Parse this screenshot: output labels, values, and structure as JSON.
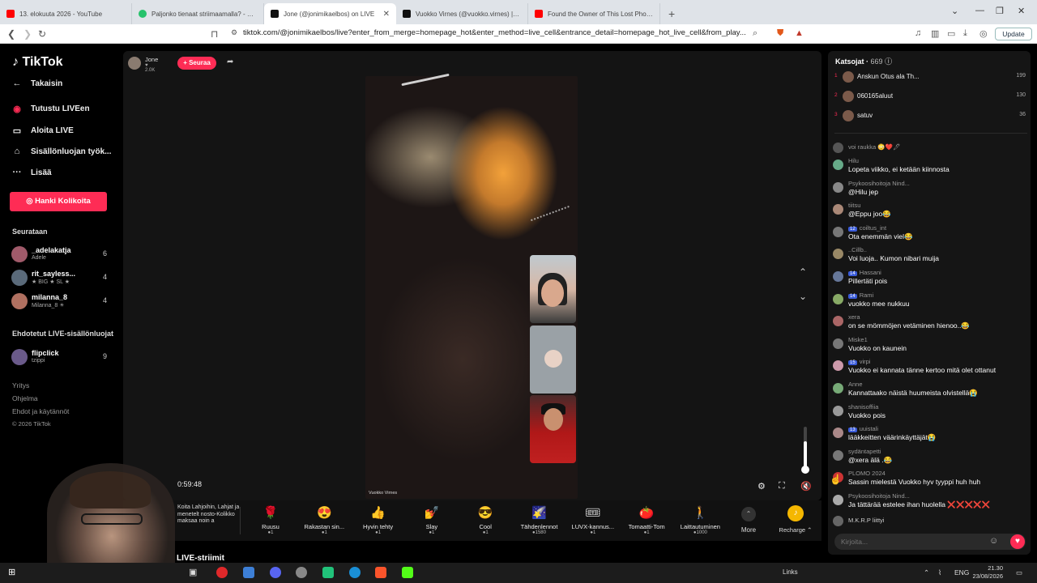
{
  "browser": {
    "tabs": [
      {
        "title": "13. elokuuta 2026 - YouTube",
        "color": "#ff0000",
        "active": false
      },
      {
        "title": "Paljonko tienaat striimaamalla? - Le...",
        "color": "#26c26b",
        "active": false
      },
      {
        "title": "Jone (@jonimikaelbos) on LIVE",
        "color": "#111111",
        "active": true
      },
      {
        "title": "Vuokko Virnes (@vuokko.virnes) | Ti...",
        "color": "#111111",
        "active": false
      },
      {
        "title": "Found the Owner of This Lost Phon...",
        "color": "#ff0000",
        "active": false
      }
    ],
    "url": "tiktok.com/@jonimikaelbos/live?enter_from_merge=homepage_hot&enter_method=live_cell&entrance_detail=homepage_hot_live_cell&from_play...",
    "update_label": "Update"
  },
  "sidebar": {
    "logo": "TikTok",
    "back": "Takaisin",
    "nav": [
      "Tutustu LIVEen",
      "Aloita LIVE",
      "Sisällönluojan työk...",
      "Lisää"
    ],
    "coins_button": "Hanki Kolikoita",
    "following_title": "Seurataan",
    "following": [
      {
        "name": "_adelakatja",
        "sub": "Adele",
        "count": "6"
      },
      {
        "name": "rit_sayless...",
        "sub": "★ BIG ★ SL ★",
        "count": "4"
      },
      {
        "name": "milanna_8",
        "sub": "Milanna_8 ☀",
        "count": "4"
      }
    ],
    "suggested_title": "Ehdotetut LIVE-sisällönluojat",
    "suggested": [
      {
        "name": "flipclick",
        "sub": "tzippi",
        "count": "9"
      }
    ],
    "footer": [
      "Yritys",
      "Ohjelma",
      "Ehdot ja käytännöt",
      "© 2026 TikTok"
    ]
  },
  "live": {
    "host_name": "Jone",
    "host_likes": "2.0K",
    "follow_button": "+ Seuraa",
    "video_credit": "Vuokko Virnes",
    "timer": "0:59:48",
    "live_label": "LIVE-striimit",
    "gift_desc": "Koita Lahjoihin, Lahjat ja menetelt nosto-Kolikko maksaa noin a"
  },
  "gifts": [
    {
      "name": "Ruusu",
      "price": "1",
      "icon": "🌹"
    },
    {
      "name": "Rakastan sin...",
      "price": "1",
      "icon": "😍"
    },
    {
      "name": "Hyvin tehty",
      "price": "1",
      "icon": "👍"
    },
    {
      "name": "Slay",
      "price": "1",
      "icon": "💅"
    },
    {
      "name": "Cool",
      "price": "1",
      "icon": "😎"
    },
    {
      "name": "Tähdenlennot",
      "price": "1580",
      "icon": "🌠"
    },
    {
      "name": "LUVX-kannus...",
      "price": "1",
      "icon": "🎟"
    },
    {
      "name": "Tomaatti-Tom",
      "price": "1",
      "icon": "🍅"
    },
    {
      "name": "Laittautuminen",
      "price": "1000",
      "icon": "🚶"
    }
  ],
  "more_label": "More",
  "recharge_label": "Recharge",
  "viewers": {
    "title": "Katsojat",
    "count": "669",
    "top": [
      {
        "rank": "1",
        "name": "Anskun Otus ala Th...",
        "score": "199"
      },
      {
        "rank": "2",
        "name": "060165aluut",
        "score": "130"
      },
      {
        "rank": "3",
        "name": "satuv",
        "score": "36"
      }
    ]
  },
  "chat": [
    {
      "user": "voi raukka 😳❤️🖊",
      "badge": "",
      "text": ""
    },
    {
      "user": "Hilu",
      "badge": "",
      "text": "Lopeta viikko, ei ketään kiinnosta"
    },
    {
      "user": "Psykoosihoitoja Nind...",
      "badge": "",
      "text": "@Hilu jep"
    },
    {
      "user": "tiitsu",
      "badge": "",
      "text": "@Eppu joo😂"
    },
    {
      "user": "coiltus_int",
      "badge": "12",
      "text": "Ota enemmän viel😂"
    },
    {
      "user": "..Cillb..",
      "badge": "",
      "text": "Voi luoja.. Kumon nibari muija"
    },
    {
      "user": "Hassani",
      "badge": "14",
      "text": "Pillertäti pois"
    },
    {
      "user": "Rami",
      "badge": "14",
      "text": "vuokko mee nukkuu"
    },
    {
      "user": "xera",
      "badge": "",
      "text": "on se mömmöjen vetäminen hienoo..😂"
    },
    {
      "user": "Miske1",
      "badge": "",
      "text": "Vuokko on kaunein"
    },
    {
      "user": "virpi",
      "badge": "15",
      "text": "Vuokko ei kannata tänne kertoo mitä olet ottanut"
    },
    {
      "user": "Anne",
      "badge": "",
      "text": "Kannattaako näistä huumeista olvistellä😭"
    },
    {
      "user": "shanisoffiia",
      "badge": "",
      "text": "Vuokko pois"
    },
    {
      "user": "uuistali",
      "badge": "13",
      "text": "lääkkeitten väärinkäyttäjät😭"
    },
    {
      "user": "sydäntapetti",
      "badge": "",
      "text": "@xera älä .😂"
    },
    {
      "user": "PLOMO 2024",
      "badge": "",
      "text": "Sassin mielestä Vuokko hyv tyyppi huh huh"
    },
    {
      "user": "Psykoosihoitoja Nind...",
      "badge": "",
      "text": "Ja tättärää esteleе ihan huolella ❌❌❌❌❌"
    },
    {
      "user": "M.K.R.P liittyi",
      "badge": "",
      "text": ""
    }
  ],
  "chat_input_placeholder": "Kirjoita...",
  "taskbar": {
    "links": "Links",
    "lang": "ENG",
    "time": "21.30",
    "date": "23/08/2026"
  }
}
